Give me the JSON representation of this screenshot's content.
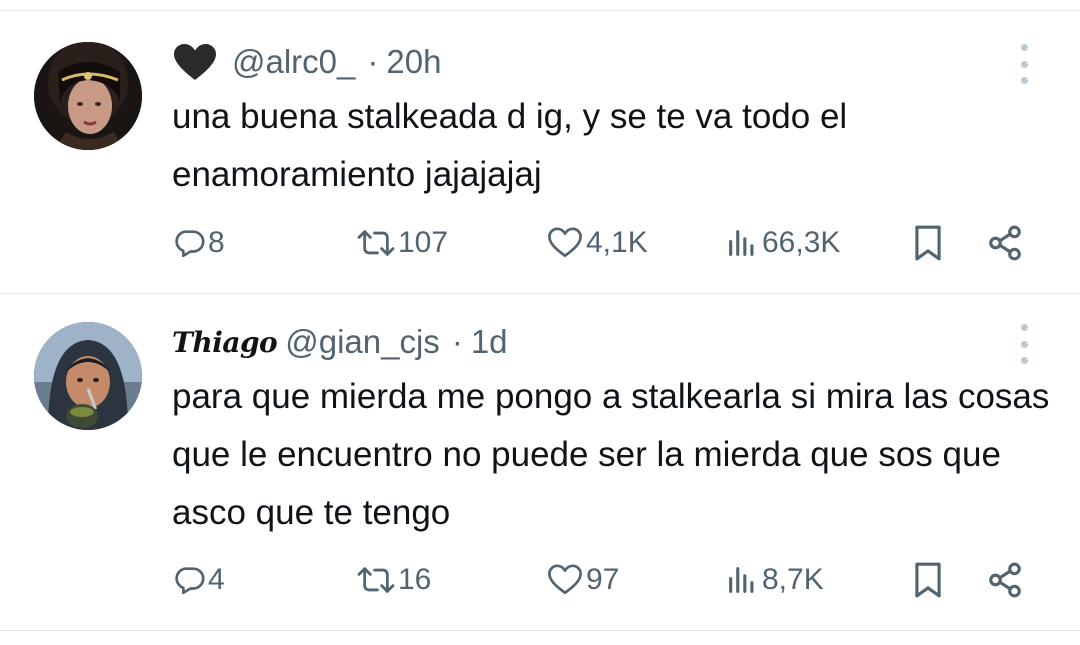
{
  "tweets": [
    {
      "display_name": "",
      "name_emoji": "black-heart",
      "handle": "@alrc0_",
      "separator": "·",
      "time": "20h",
      "text": "una buena stalkeada d ig, y se te va todo el enamoramiento jajajajaj",
      "replies": "8",
      "retweets": "107",
      "likes": "4,1K",
      "views": "66,3K"
    },
    {
      "display_name": "Thiago",
      "handle": "@gian_cjs",
      "separator": "·",
      "time": "1d",
      "text": "para que mierda me pongo a stalkearla si mira las cosas que le encuentro no puede ser la mierda que sos que asco que te tengo",
      "replies": "4",
      "retweets": "16",
      "likes": "97",
      "views": "8,7K"
    }
  ],
  "colors": {
    "text": "#0f1419",
    "secondary": "#536471",
    "divider": "#e6e9ec",
    "more_dots": "#b9cad3"
  }
}
